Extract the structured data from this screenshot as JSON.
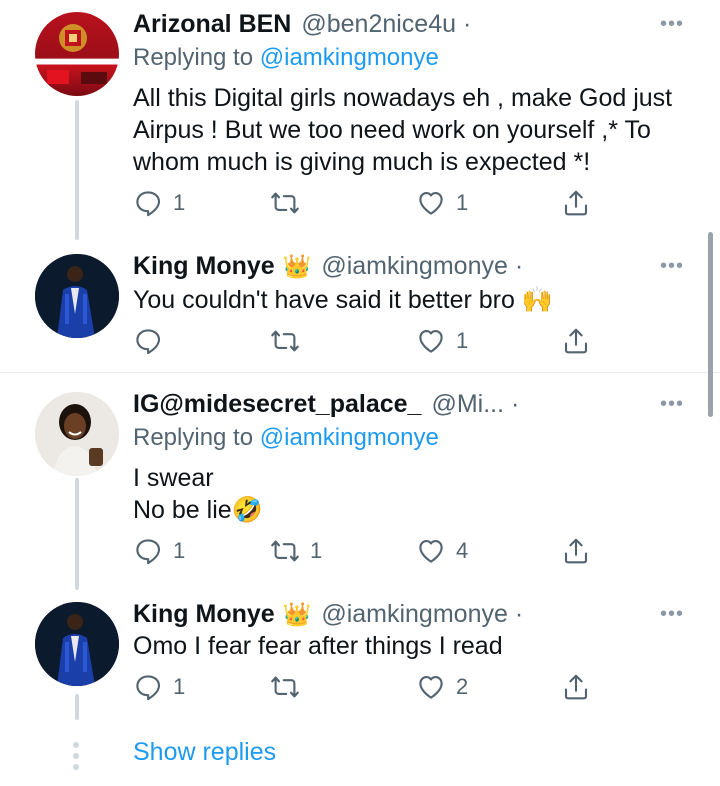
{
  "tweets": [
    {
      "name": "Arizonal BEN",
      "handle": "@ben2nice4u ·",
      "replying_prefix": "Replying to ",
      "replying_to": "@iamkingmonye",
      "text": "All this Digital girls nowadays eh , make God just Airpus ! But we too need work on yourself ,* To whom much is giving much is expected *!",
      "replies": "1",
      "retweets": "",
      "likes": "1"
    },
    {
      "name": "King Monye",
      "crown": "👑",
      "handle": "@iamkingmonye ·",
      "text": "You couldn't have said it better bro 🙌",
      "replies": "",
      "retweets": "",
      "likes": "1"
    },
    {
      "name": "IG@midesecret_palace_",
      "handle": "@Mi... ·",
      "replying_prefix": "Replying to ",
      "replying_to": "@iamkingmonye",
      "text_line1": "I swear",
      "text_line2": "No be lie🤣",
      "replies": "1",
      "retweets": "1",
      "likes": "4"
    },
    {
      "name": "King Monye",
      "crown": "👑",
      "handle": "@iamkingmonye ·",
      "text": "Omo I fear fear after things I read",
      "replies": "1",
      "retweets": "",
      "likes": "2"
    }
  ],
  "more_glyph": "•••",
  "show_replies": "Show replies",
  "icons": {
    "reply": "reply-icon",
    "retweet": "retweet-icon",
    "like": "heart-icon",
    "share": "share-icon",
    "more": "more-options-icon"
  },
  "colors": {
    "link": "#1d9bf0",
    "muted": "#536471",
    "text": "#0f1419"
  }
}
